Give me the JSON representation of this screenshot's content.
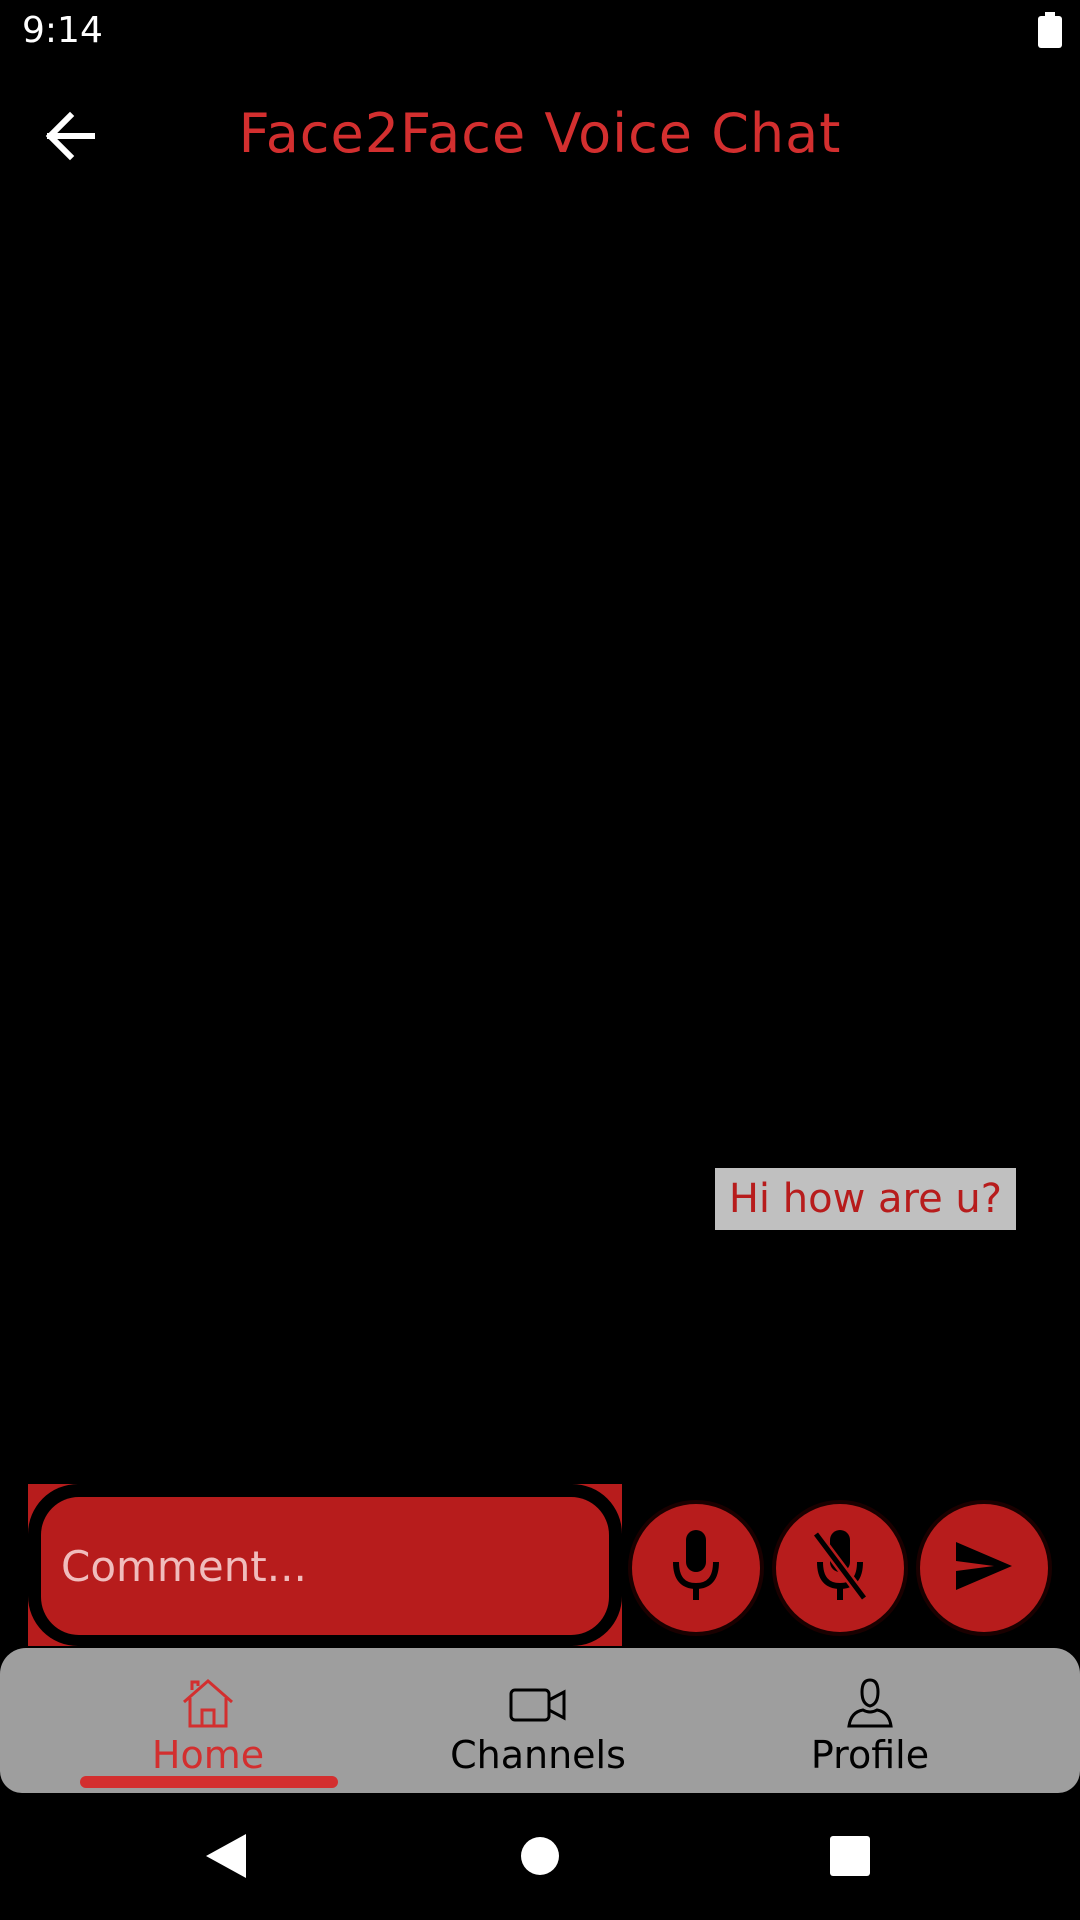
{
  "status_bar": {
    "time": "9:14",
    "battery_icon": "battery-full-icon"
  },
  "app_bar": {
    "back_icon": "arrow-back-icon",
    "title": "Face2Face Voice Chat"
  },
  "chat": {
    "messages": [
      {
        "text": "Hi how are u?"
      }
    ]
  },
  "input": {
    "placeholder": "Comment...",
    "value": ""
  },
  "actions": {
    "mic_icon": "mic-icon",
    "mic_off_icon": "mic-off-icon",
    "send_icon": "send-icon"
  },
  "bottom_nav": {
    "items": [
      {
        "label": "Home",
        "icon": "home-icon",
        "active": true
      },
      {
        "label": "Channels",
        "icon": "video-camera-icon",
        "active": false
      },
      {
        "label": "Profile",
        "icon": "person-icon",
        "active": false
      }
    ]
  },
  "colors": {
    "accent": "#d32f2f",
    "primary_dark": "#b71c1c",
    "background": "#000000",
    "nav_background": "#9e9e9e",
    "bubble_background": "#c0c0c0"
  }
}
